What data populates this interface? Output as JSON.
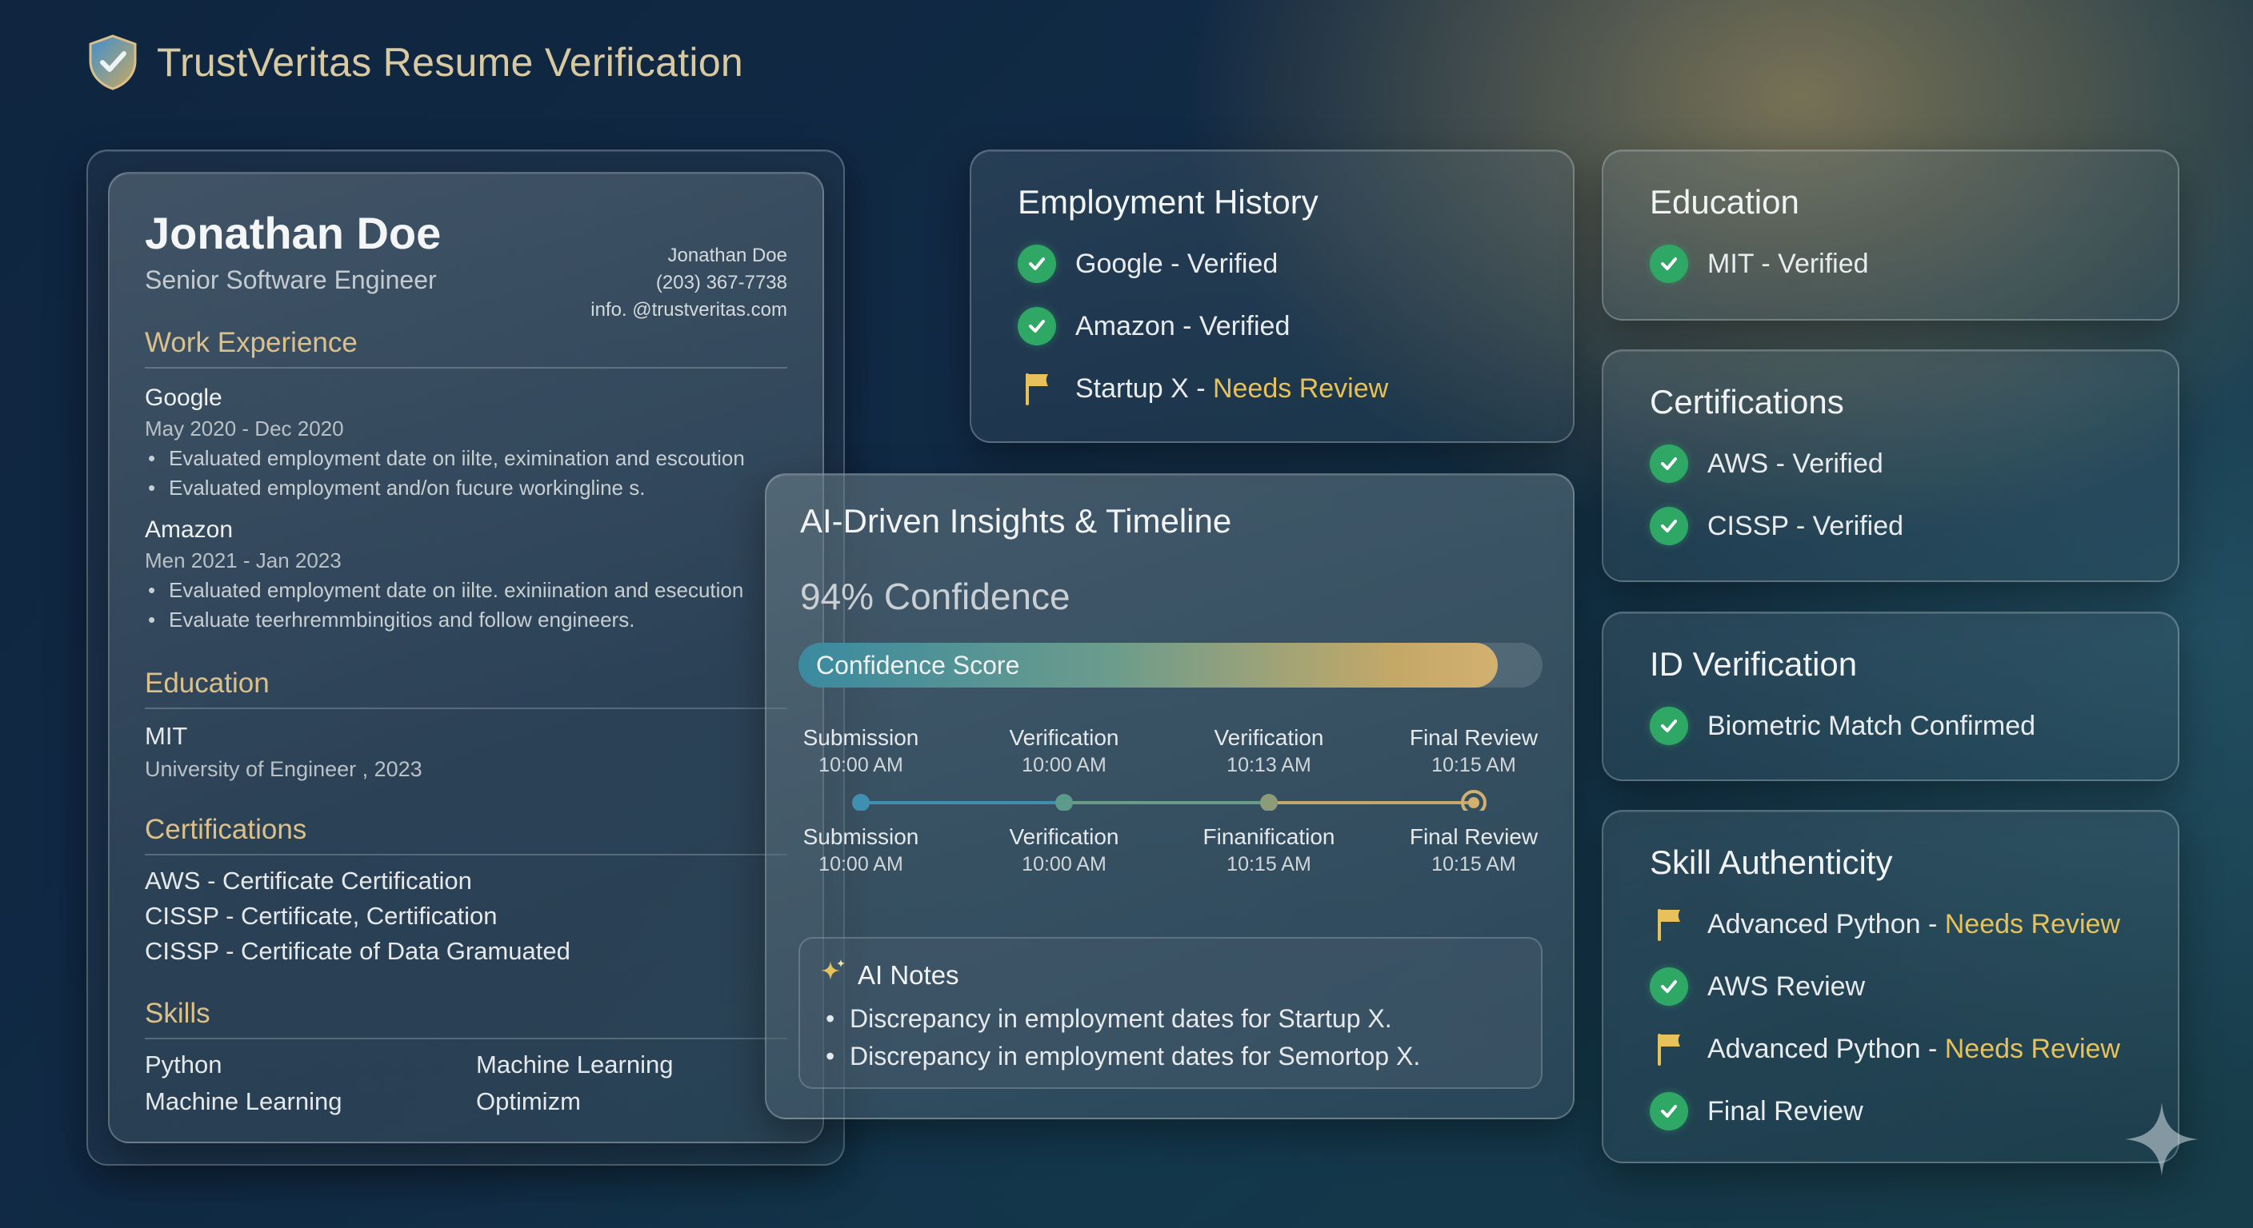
{
  "header": {
    "title": "TrustVeritas Resume Verification"
  },
  "resume": {
    "name": "Jonathan Doe",
    "role": "Senior Software Engineer",
    "contact": [
      "Jonathan Doe",
      "(203) 367-7738",
      "info. @trustveritas.com"
    ],
    "work_title": "Work Experience",
    "jobs": [
      {
        "company": "Google",
        "dates": "May 2020 - Dec 2020",
        "bullets": [
          "Evaluated employment date on iilte, eximination and escoution",
          "Evaluated employment and/on fucure workingline s."
        ]
      },
      {
        "company": "Amazon",
        "dates": "Men 2021 - Jan 2023",
        "bullets": [
          "Evaluated employment date on iilte. exiniination and esecution",
          "Evaluate teerhremmbingitios and follow engineers."
        ]
      }
    ],
    "education_title": "Education",
    "education": {
      "school": "MIT",
      "degree": "University of Engineer , 2023"
    },
    "certs_title": "Certifications",
    "certs": [
      "AWS - Certificate Certification",
      "CISSP - Certificate, Certification",
      "CISSP - Certificate of Data Gramuated"
    ],
    "skills_title": "Skills",
    "skills": [
      "Python",
      "Machine Learning",
      "Machine Learning",
      "Optimizm"
    ]
  },
  "employment": {
    "title": "Employment History",
    "items": [
      {
        "status": "verified",
        "label": "Google - Verified",
        "review": ""
      },
      {
        "status": "verified",
        "label": "Amazon - Verified",
        "review": ""
      },
      {
        "status": "review",
        "label": "Startup X - ",
        "review": "Needs Review"
      }
    ]
  },
  "education_card": {
    "title": "Education",
    "items": [
      {
        "status": "verified",
        "label": "MIT - Verified"
      }
    ]
  },
  "certs_card": {
    "title": "Certifications",
    "items": [
      {
        "status": "verified",
        "label": "AWS - Verified"
      },
      {
        "status": "verified",
        "label": "CISSP - Verified"
      }
    ]
  },
  "idv_card": {
    "title": "ID Verification",
    "items": [
      {
        "status": "verified",
        "label": "Biometric Match Confirmed"
      }
    ]
  },
  "skill_card": {
    "title": "Skill Authenticity",
    "items": [
      {
        "status": "review",
        "label": "Advanced Python - ",
        "review": "Needs Review"
      },
      {
        "status": "verified",
        "label": "AWS Review",
        "review": ""
      },
      {
        "status": "review",
        "label": "Advanced Python - ",
        "review": "Needs Review"
      },
      {
        "status": "verified",
        "label": "Final Review",
        "review": ""
      }
    ]
  },
  "insights": {
    "title": "AI-Driven Insights & Timeline",
    "confidence_text": "94% Confidence",
    "bar_label": "Confidence Score",
    "confidence": 0.94,
    "timeline_top": [
      {
        "label": "Submission",
        "time": "10:00 AM"
      },
      {
        "label": "Verification",
        "time": "10:00 AM"
      },
      {
        "label": "Verification",
        "time": "10:13 AM"
      },
      {
        "label": "Final Review",
        "time": "10:15 AM"
      }
    ],
    "timeline_bottom": [
      {
        "label": "Submission",
        "time": "10:00 AM"
      },
      {
        "label": "Verification",
        "time": "10:00 AM"
      },
      {
        "label": "Finanification",
        "time": "10:15 AM"
      },
      {
        "label": "Final Review",
        "time": "10:15 AM"
      }
    ],
    "notes_title": "AI Notes",
    "notes": [
      "Discrepancy in employment dates for Startup X.",
      "Discrepancy in employment dates for Semortop X."
    ]
  },
  "colors": {
    "verified": "#2fa866",
    "review": "#e7c25a",
    "accent_gold": "#dcc08a"
  }
}
